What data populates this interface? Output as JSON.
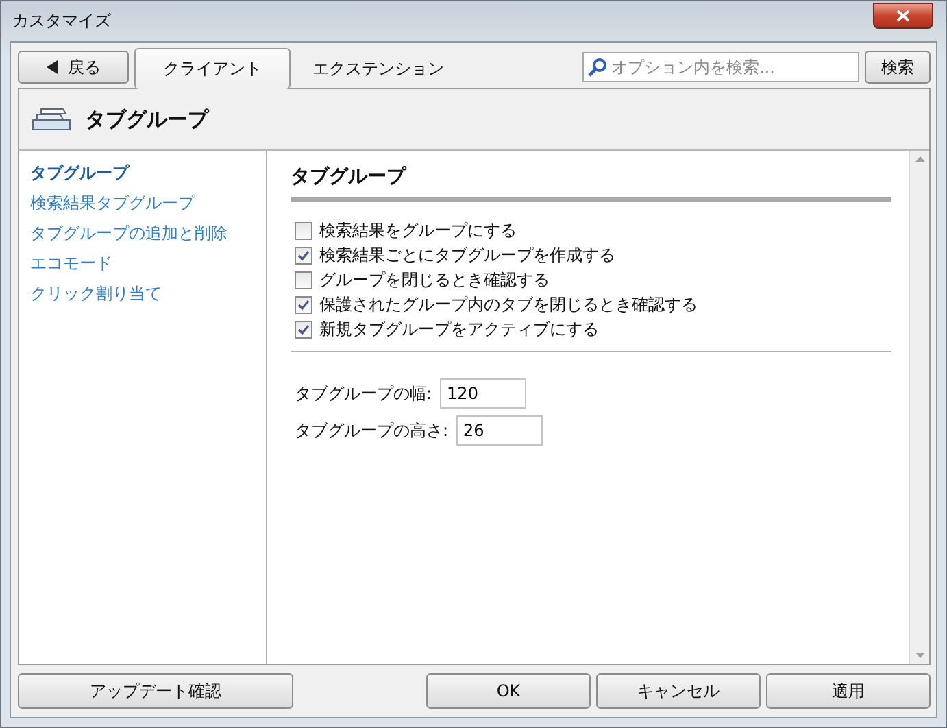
{
  "window": {
    "title": "カスタマイズ"
  },
  "toolbar": {
    "back_button": "戻る",
    "tabs": [
      {
        "label": "クライアント",
        "selected": true
      },
      {
        "label": "エクステンション",
        "selected": false
      }
    ],
    "search": {
      "placeholder": "オプション内を検索...",
      "button": "検索"
    }
  },
  "page": {
    "title": "タブグループ"
  },
  "sidebar": {
    "items": [
      {
        "label": "タブグループ",
        "selected": true
      },
      {
        "label": "検索結果タブグループ",
        "selected": false
      },
      {
        "label": "タブグループの追加と削除",
        "selected": false
      },
      {
        "label": "エコモード",
        "selected": false
      },
      {
        "label": "クリック割り当て",
        "selected": false
      }
    ]
  },
  "section": {
    "title": "タブグループ",
    "options": [
      {
        "label": "検索結果をグループにする",
        "checked": false
      },
      {
        "label": "検索結果ごとにタブグループを作成する",
        "checked": true
      },
      {
        "label": "グループを閉じるとき確認する",
        "checked": false
      },
      {
        "label": "保護されたグループ内のタブを閉じるとき確認する",
        "checked": true
      },
      {
        "label": "新規タブグループをアクティブにする",
        "checked": true
      }
    ],
    "fields": [
      {
        "label": "タブグループの幅:",
        "value": "120"
      },
      {
        "label": "タブグループの高さ:",
        "value": "26"
      }
    ]
  },
  "buttons": {
    "update": "アップデート確認",
    "actions": [
      "OK",
      "キャンセル",
      "適用"
    ]
  }
}
